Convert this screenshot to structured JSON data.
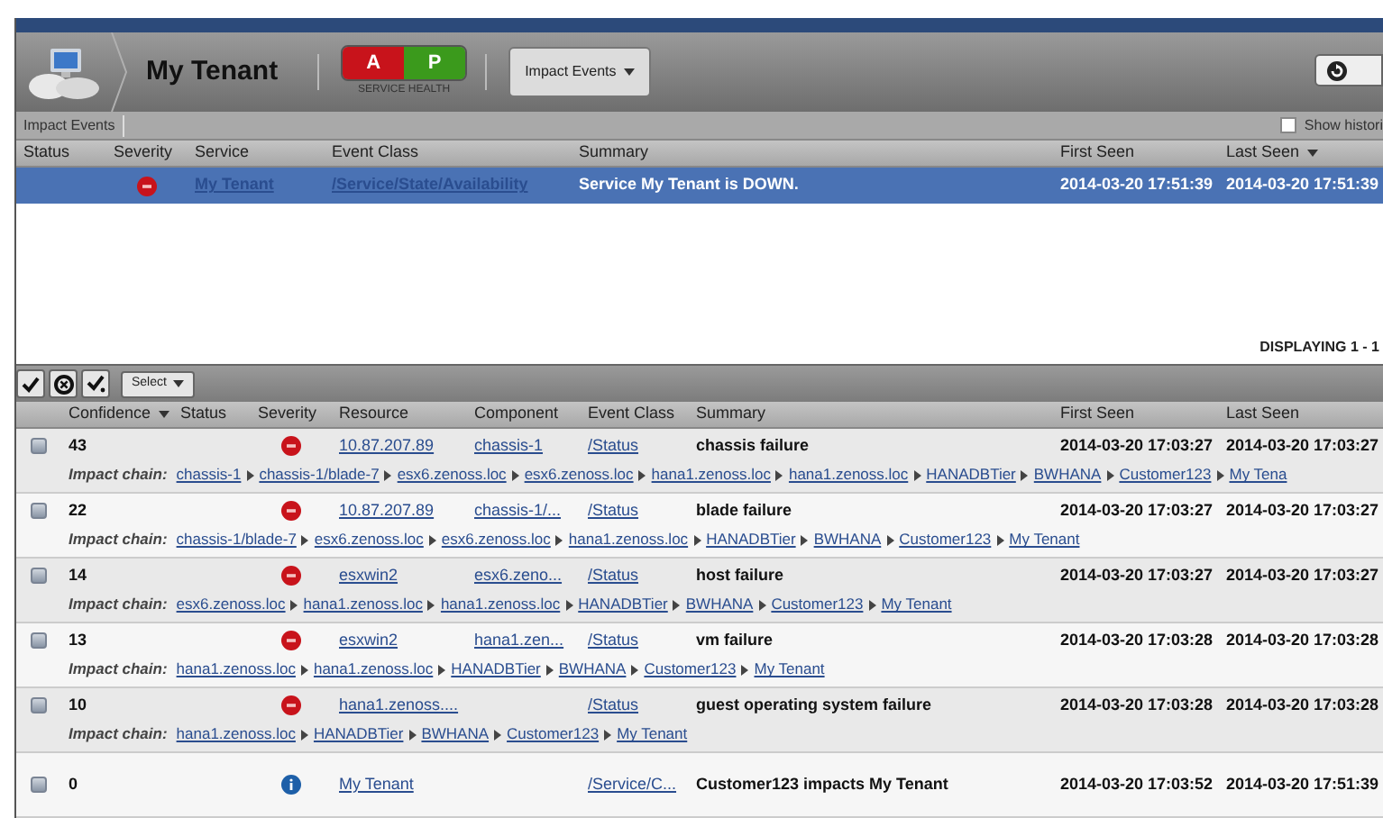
{
  "header": {
    "title": "My Tenant",
    "health": [
      {
        "label": "A",
        "color": "#c8131b"
      },
      {
        "label": "P",
        "color": "#3b9a1c"
      }
    ],
    "health_label": "SERVICE HEALTH",
    "view_menu": "Impact Events"
  },
  "upper_panel": {
    "tab": "Impact Events",
    "show_history": {
      "label": "Show histori",
      "checked": false
    },
    "columns": [
      {
        "label": "Status",
        "sorted": false
      },
      {
        "label": "Severity",
        "sorted": false
      },
      {
        "label": "Service",
        "sorted": false
      },
      {
        "label": "Event Class",
        "sorted": false
      },
      {
        "label": "Summary",
        "sorted": false
      },
      {
        "label": "First Seen",
        "sorted": false
      },
      {
        "label": "Last Seen",
        "sorted": true
      }
    ],
    "rows": [
      {
        "kind": "critical",
        "service": "My Tenant",
        "event_class": "/Service/State/Availability",
        "summary": "Service My Tenant is DOWN.",
        "first_seen": "2014-03-20 17:51:39",
        "last_seen": "2014-03-20 17:51:39",
        "selected": true
      }
    ],
    "paging": "DISPLAYING 1 - 1"
  },
  "lower_panel": {
    "select_menu": "Select",
    "columns": [
      {
        "label": "Confidence",
        "sorted": true
      },
      {
        "label": "Status",
        "sorted": false
      },
      {
        "label": "Severity",
        "sorted": false
      },
      {
        "label": "Resource",
        "sorted": false
      },
      {
        "label": "Component",
        "sorted": false
      },
      {
        "label": "Event Class",
        "sorted": false
      },
      {
        "label": "Summary",
        "sorted": false
      },
      {
        "label": "First Seen",
        "sorted": false
      },
      {
        "label": "Last Seen",
        "sorted": false
      }
    ],
    "rows": [
      {
        "confidence": "43",
        "kind": "critical",
        "resource": "10.87.207.89",
        "component": "chassis-1",
        "event_class": "/Status",
        "summary": "chassis failure",
        "first_seen": "2014-03-20 17:03:27",
        "last_seen": "2014-03-20 17:03:27",
        "chain_label": "Impact chain:",
        "chain": [
          "chassis-1",
          "chassis-1/blade-7",
          "esx6.zenoss.loc",
          "esx6.zenoss.loc",
          "hana1.zenoss.loc",
          "hana1.zenoss.loc",
          "HANADBTier",
          "BWHANA",
          "Customer123",
          "My Tena"
        ]
      },
      {
        "confidence": "22",
        "kind": "critical",
        "resource": "10.87.207.89",
        "component": "chassis-1/...",
        "event_class": "/Status",
        "summary": "blade failure",
        "first_seen": "2014-03-20 17:03:27",
        "last_seen": "2014-03-20 17:03:27",
        "chain_label": "Impact chain:",
        "chain": [
          "chassis-1/blade-7",
          "esx6.zenoss.loc",
          "esx6.zenoss.loc",
          "hana1.zenoss.loc",
          "HANADBTier",
          "BWHANA",
          "Customer123",
          "My Tenant"
        ]
      },
      {
        "confidence": "14",
        "kind": "critical",
        "resource": "esxwin2",
        "component": "esx6.zeno...",
        "event_class": "/Status",
        "summary": "host failure",
        "first_seen": "2014-03-20 17:03:27",
        "last_seen": "2014-03-20 17:03:27",
        "chain_label": "Impact chain:",
        "chain": [
          "esx6.zenoss.loc",
          "hana1.zenoss.loc",
          "hana1.zenoss.loc",
          "HANADBTier",
          "BWHANA",
          "Customer123",
          "My Tenant"
        ]
      },
      {
        "confidence": "13",
        "kind": "critical",
        "resource": "esxwin2",
        "component": "hana1.zen...",
        "event_class": "/Status",
        "summary": "vm failure",
        "first_seen": "2014-03-20 17:03:28",
        "last_seen": "2014-03-20 17:03:28",
        "chain_label": "Impact chain:",
        "chain": [
          "hana1.zenoss.loc",
          "hana1.zenoss.loc",
          "HANADBTier",
          "BWHANA",
          "Customer123",
          "My Tenant"
        ]
      },
      {
        "confidence": "10",
        "kind": "critical",
        "resource": "hana1.zenoss....",
        "event_class": "/Status",
        "summary": "guest operating system failure",
        "first_seen": "2014-03-20 17:03:28",
        "last_seen": "2014-03-20 17:03:28",
        "chain_label": "Impact chain:",
        "chain": [
          "hana1.zenoss.loc",
          "HANADBTier",
          "BWHANA",
          "Customer123",
          "My Tenant"
        ]
      },
      {
        "confidence": "0",
        "kind": "info",
        "resource": "My Tenant",
        "event_class": "/Service/C...",
        "summary": "Customer123 impacts My Tenant",
        "first_seen": "2014-03-20 17:03:52",
        "last_seen": "2014-03-20 17:51:39"
      }
    ]
  }
}
